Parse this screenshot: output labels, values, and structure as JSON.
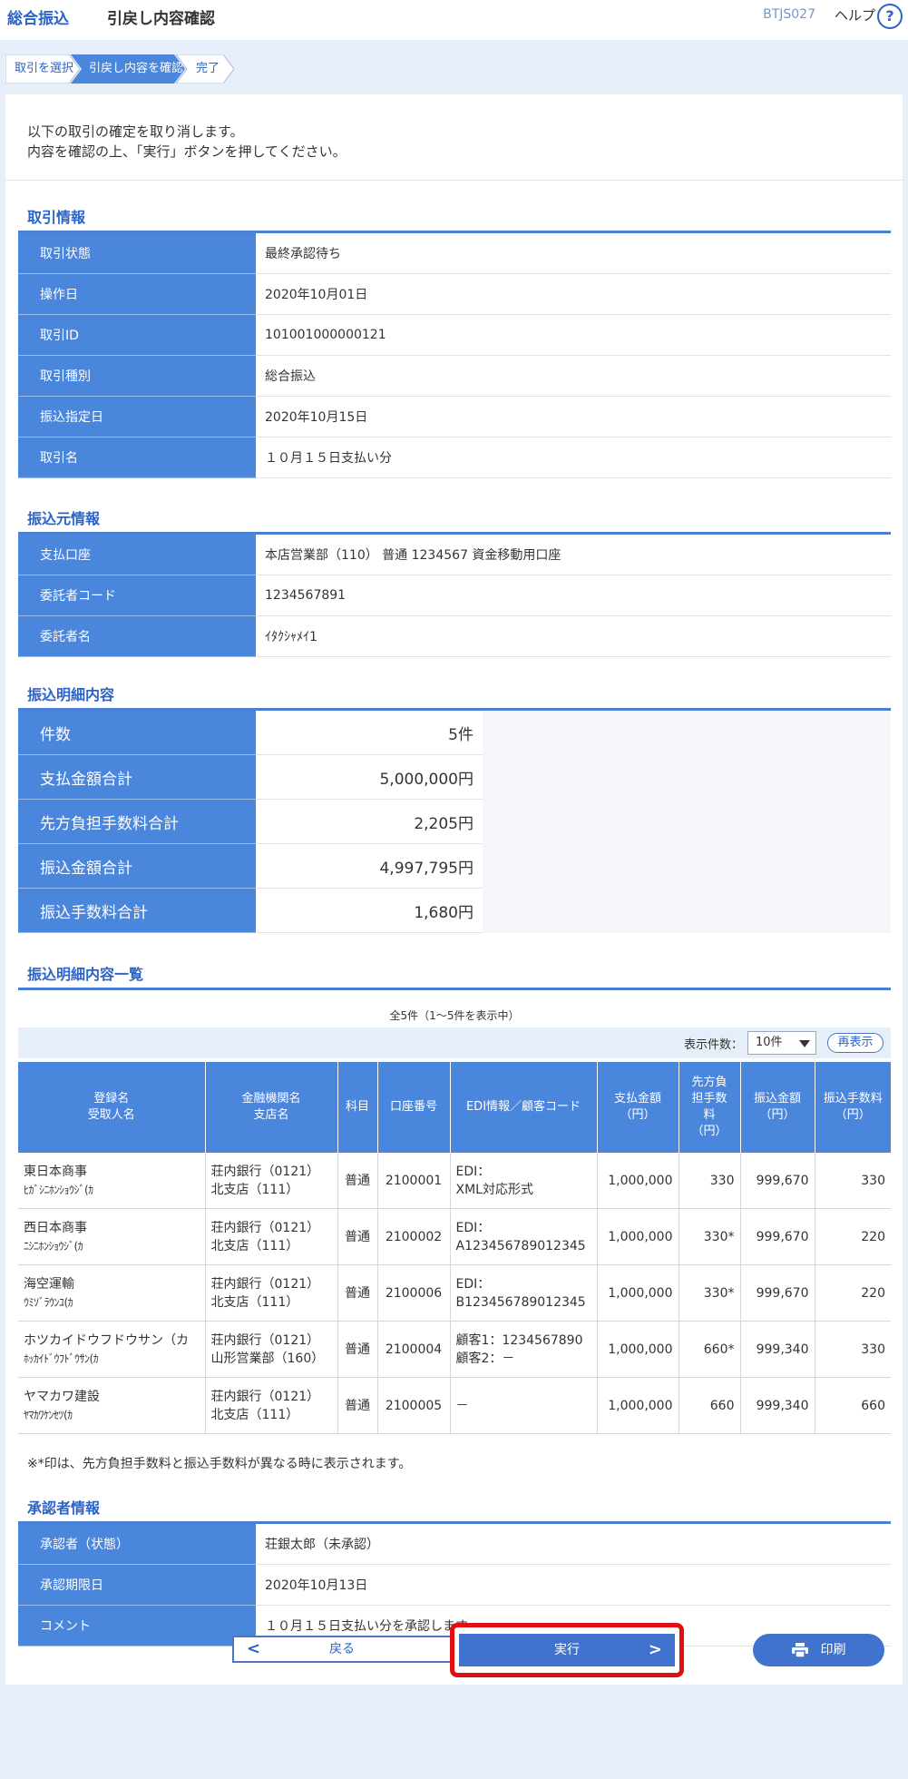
{
  "header": {
    "brand": "総合振込",
    "page_title": "引戻し内容確認",
    "screen_id": "BTJS027",
    "help_label": "ヘルプ",
    "help_icon": "?"
  },
  "steps": [
    "取引を選択",
    "引戻し内容を確認",
    "完了"
  ],
  "intro": {
    "line1": "以下の取引の確定を取り消します。",
    "line2": "内容を確認の上、「実行」ボタンを押してください。"
  },
  "transaction": {
    "title": "取引情報",
    "rows": [
      {
        "label": "取引状態",
        "value": "最終承認待ち"
      },
      {
        "label": "操作日",
        "value": "2020年10月01日"
      },
      {
        "label": "取引ID",
        "value": "101001000000121"
      },
      {
        "label": "取引種別",
        "value": "総合振込"
      },
      {
        "label": "振込指定日",
        "value": "2020年10月15日"
      },
      {
        "label": "取引名",
        "value": "１０月１５日支払い分"
      }
    ]
  },
  "source": {
    "title": "振込元情報",
    "rows": [
      {
        "label": "支払口座",
        "value": "本店営業部（110） 普通 1234567 資金移動用口座"
      },
      {
        "label": "委託者コード",
        "value": "1234567891"
      },
      {
        "label": "委託者名",
        "value": "ｲﾀｸｼｬﾒｲ1"
      }
    ]
  },
  "summary": {
    "title": "振込明細内容",
    "rows": [
      {
        "label": "件数",
        "value": "5件"
      },
      {
        "label": "支払金額合計",
        "value": "5,000,000円"
      },
      {
        "label": "先方負担手数料合計",
        "value": "2,205円"
      },
      {
        "label": "振込金額合計",
        "value": "4,997,795円"
      },
      {
        "label": "振込手数料合計",
        "value": "1,680円"
      }
    ]
  },
  "list": {
    "title": "振込明細内容一覧",
    "count_text": "全5件（1～5件を表示中）",
    "per_page_label": "表示件数：",
    "per_page_value": "10件",
    "redisplay_label": "再表示",
    "headers": {
      "name1": "登録名",
      "name2": "受取人名",
      "bank1": "金融機関名",
      "bank2": "支店名",
      "kamoku": "科目",
      "account": "口座番号",
      "edi": "EDI情報／顧客コード",
      "pay1": "支払金額",
      "pay2": "（円）",
      "fee1": "先方負",
      "fee2": "担手数",
      "fee3": "料",
      "fee4": "（円）",
      "transfer1": "振込金額",
      "transfer2": "（円）",
      "tfee1": "振込手数料",
      "tfee2": "（円）"
    },
    "rows": [
      {
        "name": "東日本商事",
        "kana": "ﾋｶﾞｼﾆﾎﾝｼｮｳｼﾞ(ｶ",
        "bank": "荘内銀行（0121）",
        "branch": "北支店（111）",
        "kamoku": "普通",
        "account": "2100001",
        "edi1": "EDI：",
        "edi2": "XML対応形式",
        "pay": "1,000,000",
        "fee": "330",
        "transfer": "999,670",
        "tfee": "330"
      },
      {
        "name": "西日本商事",
        "kana": "ﾆｼﾆﾎﾝｼｮｳｼﾞ(ｶ",
        "bank": "荘内銀行（0121）",
        "branch": "北支店（111）",
        "kamoku": "普通",
        "account": "2100002",
        "edi1": "EDI：",
        "edi2": "A123456789012345",
        "pay": "1,000,000",
        "fee": "330*",
        "transfer": "999,670",
        "tfee": "220"
      },
      {
        "name": "海空運輸",
        "kana": "ｳﾐｿﾞﾗｳﾝﾕ(ｶ",
        "bank": "荘内銀行（0121）",
        "branch": "北支店（111）",
        "kamoku": "普通",
        "account": "2100006",
        "edi1": "EDI：",
        "edi2": "B123456789012345",
        "pay": "1,000,000",
        "fee": "330*",
        "transfer": "999,670",
        "tfee": "220"
      },
      {
        "name": "ホツカイドウフドウサン（カ",
        "kana": "ﾎｯｶｲﾄﾞｳﾌﾄﾞｳｻﾝ(ｶ",
        "bank": "荘内銀行（0121）",
        "branch": "山形営業部（160）",
        "kamoku": "普通",
        "account": "2100004",
        "edi1": "顧客1：1234567890",
        "edi2": "顧客2：－",
        "pay": "1,000,000",
        "fee": "660*",
        "transfer": "999,340",
        "tfee": "330"
      },
      {
        "name": "ヤマカワ建設",
        "kana": "ﾔﾏｶﾜｹﾝｾﾂ(ｶ",
        "bank": "荘内銀行（0121）",
        "branch": "北支店（111）",
        "kamoku": "普通",
        "account": "2100005",
        "edi1": "－",
        "edi2": "",
        "pay": "1,000,000",
        "fee": "660",
        "transfer": "999,340",
        "tfee": "660"
      }
    ],
    "note": "※*印は、先方負担手数料と振込手数料が異なる時に表示されます。"
  },
  "approver": {
    "title": "承認者情報",
    "rows": [
      {
        "label": "承認者（状態）",
        "value": "荘銀太郎（未承認）"
      },
      {
        "label": "承認期限日",
        "value": "2020年10月13日"
      },
      {
        "label": "コメント",
        "value": "１０月１５日支払い分を承認します。"
      }
    ]
  },
  "buttons": {
    "back": "戻る",
    "execute": "実行",
    "print": "印刷"
  },
  "colors": {
    "accent": "#2b63c6",
    "header_cell": "#4b86dd",
    "highlight": "#e01010"
  }
}
